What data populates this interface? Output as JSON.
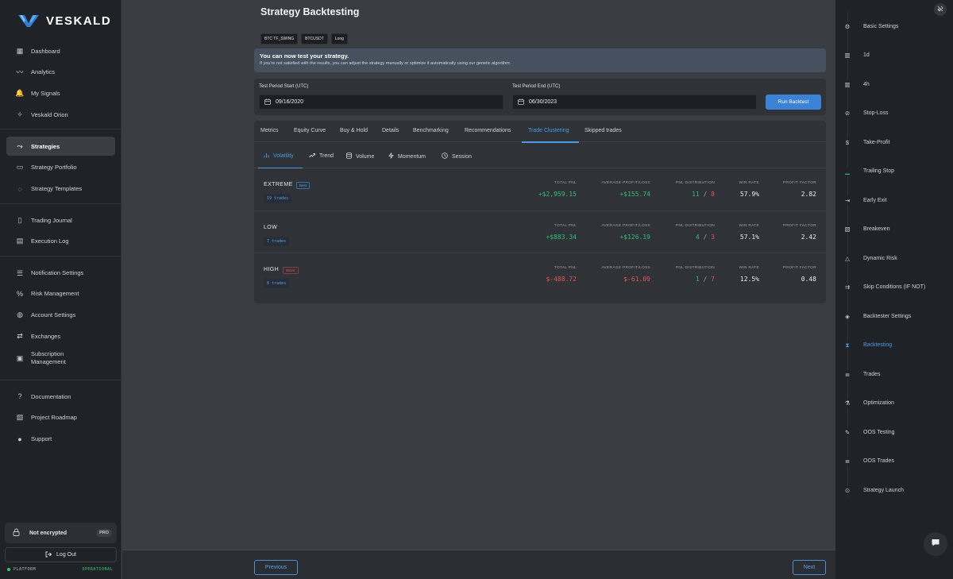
{
  "brand": {
    "name": "VESKALD"
  },
  "sidebar": {
    "groups": [
      [
        {
          "label": "Dashboard",
          "icon": "grid-icon"
        },
        {
          "label": "Analytics",
          "icon": "pulse-icon"
        },
        {
          "label": "My Signals",
          "icon": "bell-icon"
        },
        {
          "label": "Veskald Orion",
          "icon": "orion-icon"
        }
      ],
      [
        {
          "label": "Strategies",
          "icon": "route-icon",
          "active": true
        },
        {
          "label": "Strategy Portfolio",
          "icon": "briefcase-icon"
        },
        {
          "label": "Strategy Templates",
          "icon": "lightbulb-icon"
        }
      ],
      [
        {
          "label": "Trading Journal",
          "icon": "book-icon"
        },
        {
          "label": "Execution Log",
          "icon": "log-icon"
        }
      ],
      [
        {
          "label": "Notification Settings",
          "icon": "sliders-icon"
        },
        {
          "label": "Risk Management",
          "icon": "percent-icon"
        },
        {
          "label": "Account Settings",
          "icon": "user-gear-icon"
        },
        {
          "label": "Exchanges",
          "icon": "arrows-icon"
        },
        {
          "label": "Subscription Management",
          "icon": "calendar-icon"
        }
      ],
      [
        {
          "label": "Documentation",
          "icon": "help-icon"
        },
        {
          "label": "Project Roadmap",
          "icon": "map-icon"
        },
        {
          "label": "Support",
          "icon": "chat-icon"
        }
      ]
    ],
    "encryption": {
      "label": "Not encrypted",
      "plan": "PRO"
    },
    "logout_label": "Log Out",
    "platform": {
      "label": "PLATFORM",
      "status": "OPERATIONAL"
    }
  },
  "page": {
    "title": "Strategy Backtesting",
    "tags": [
      "BTC TF_SWING",
      "BTCUSDT",
      "Long"
    ],
    "info": {
      "heading": "You can now test your strategy.",
      "text": "If you're not satisfied with the results, you can adjust the strategy manually or optimize it automatically using our genetic algorithm."
    },
    "period": {
      "start_label": "Test Period Start (UTC)",
      "start_value": "09/16/2020",
      "end_label": "Test Period End (UTC)",
      "end_value": "06/30/2023",
      "run_label": "Run Backtest"
    },
    "tabs": [
      "Metrics",
      "Equity Curve",
      "Buy & Hold",
      "Details",
      "Benchmarking",
      "Recommendations",
      "Trade Clustering",
      "Skipped trades"
    ],
    "active_tab": "Trade Clustering",
    "subtabs": [
      "Volatility",
      "Trend",
      "Volume",
      "Momentum",
      "Session"
    ],
    "active_subtab": "Volatility",
    "metric_labels": {
      "total_pnl": "TOTAL PNL",
      "avg": "AVERAGE PROFIT/LOSS",
      "dist": "PNL DISTRIBUTION",
      "win": "WIN RATE",
      "pf": "PROFIT FACTOR"
    },
    "clusters": [
      {
        "name": "EXTREME",
        "badge": "Best",
        "badge_type": "best",
        "trades": "19 trades",
        "total_pnl": "+$2,959.15",
        "avg": "+$155.74",
        "dist_win": "11",
        "dist_sep": " / ",
        "dist_loss": "8",
        "win_rate": "57.9%",
        "pf": "2.82",
        "pnl_sign": "pos"
      },
      {
        "name": "LOW",
        "badge": "",
        "badge_type": "",
        "trades": "7 trades",
        "total_pnl": "+$883.34",
        "avg": "+$126.19",
        "dist_win": "4",
        "dist_sep": " / ",
        "dist_loss": "3",
        "win_rate": "57.1%",
        "pf": "2.42",
        "pnl_sign": "pos"
      },
      {
        "name": "HIGH",
        "badge": "Worst",
        "badge_type": "worst",
        "trades": "8 trades",
        "total_pnl": "$-488.72",
        "avg": "$-61.09",
        "dist_win": "1",
        "dist_sep": " / ",
        "dist_loss": "7",
        "win_rate": "12.5%",
        "pf": "0.48",
        "pnl_sign": "neg"
      }
    ],
    "prev_label": "Previous",
    "next_label": "Next"
  },
  "steps": [
    {
      "label": "Basic Settings",
      "icon": "gear-icon"
    },
    {
      "label": "1d",
      "icon": "chart-icon"
    },
    {
      "label": "4h",
      "icon": "chart-icon"
    },
    {
      "label": "Stop-Loss",
      "icon": "ban-icon"
    },
    {
      "label": "Take-Profit",
      "icon": "dollar-icon"
    },
    {
      "label": "Trailing Stop",
      "icon": "bar-chart-icon"
    },
    {
      "label": "Early Exit",
      "icon": "exit-icon"
    },
    {
      "label": "Breakeven",
      "icon": "save-icon"
    },
    {
      "label": "Dynamic Risk",
      "icon": "triangle-icon"
    },
    {
      "label": "Skip Conditions (IF NOT)",
      "icon": "skip-icon"
    },
    {
      "label": "Backtester Settings",
      "icon": "cube-icon"
    },
    {
      "label": "Backtesting",
      "icon": "hourglass-icon",
      "active": true
    },
    {
      "label": "Trades",
      "icon": "list-icon"
    },
    {
      "label": "Optimization",
      "icon": "flask-icon"
    },
    {
      "label": "OOS Testing",
      "icon": "pen-icon"
    },
    {
      "label": "OOS Trades",
      "icon": "list-icon"
    },
    {
      "label": "Strategy Launch",
      "icon": "rocket-icon"
    }
  ]
}
